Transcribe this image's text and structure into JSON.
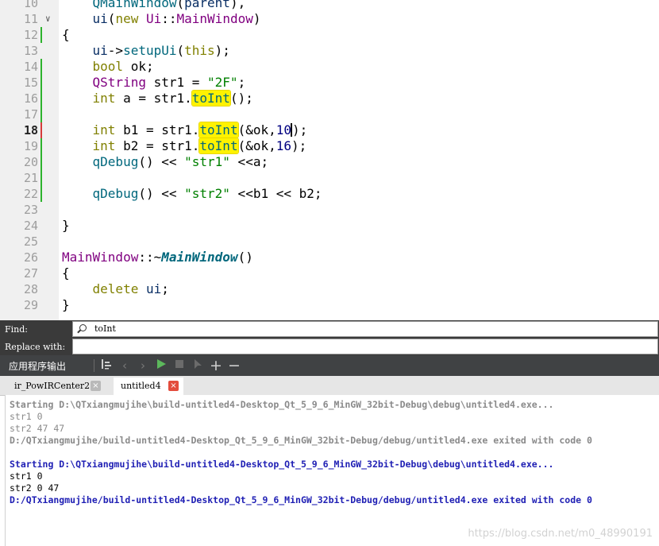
{
  "editor": {
    "line_numbers": [
      "10",
      "11",
      "12",
      "13",
      "14",
      "15",
      "16",
      "17",
      "18",
      "19",
      "20",
      "21",
      "22",
      "23",
      "24",
      "25",
      "26",
      "27",
      "28",
      "29"
    ],
    "current_line": "18",
    "search_highlight": "toInt"
  },
  "find": {
    "find_label": "Find:",
    "replace_label": "Replace with:",
    "find_value": "toInt",
    "replace_value": ""
  },
  "output_pane": {
    "title": "应用程序输出",
    "tabs": [
      {
        "label": "ir_PowIRCenter2",
        "close": "×"
      },
      {
        "label": "untitled4",
        "close": "×"
      }
    ],
    "lines": [
      "Starting D:\\QTxiangmujihe\\build-untitled4-Desktop_Qt_5_9_6_MinGW_32bit-Debug\\debug\\untitled4.exe...",
      "str1 0",
      "str2 47 47",
      "D:/QTxiangmujihe/build-untitled4-Desktop_Qt_5_9_6_MinGW_32bit-Debug/debug/untitled4.exe exited with code 0",
      "",
      "Starting D:\\QTxiangmujihe\\build-untitled4-Desktop_Qt_5_9_6_MinGW_32bit-Debug\\debug\\untitled4.exe...",
      "str1 0",
      "str2 0 47",
      "D:/QTxiangmujihe/build-untitled4-Desktop_Qt_5_9_6_MinGW_32bit-Debug/debug/untitled4.exe exited with code 0"
    ]
  },
  "watermark": "https://blog.csdn.net/m0_48990191",
  "colors": {
    "gutter_bg": "#f0f0f0",
    "highlight": "#fff200",
    "pane_header": "#404244",
    "run_green": "#5cb85c",
    "close_red": "#e34c3c",
    "output_blue": "#1f1fb4"
  },
  "icons": [
    "search-icon",
    "filter-icon",
    "prev-icon",
    "next-icon",
    "run-icon",
    "stop-icon",
    "attach-icon",
    "zoom-in-icon",
    "zoom-out-icon",
    "close-icon",
    "fold-arrow-icon"
  ]
}
